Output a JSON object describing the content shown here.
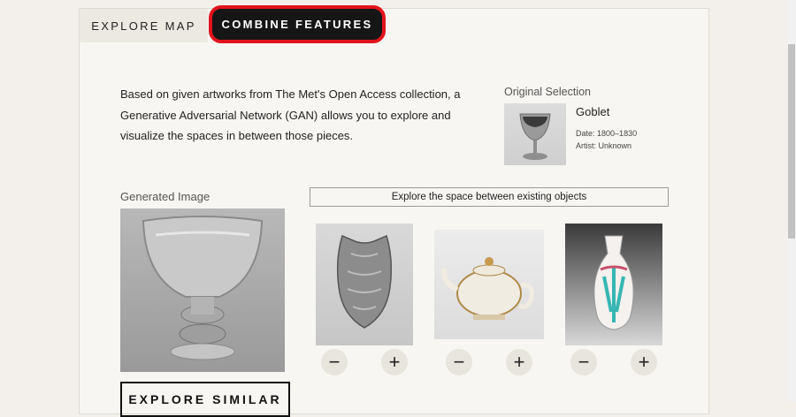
{
  "tabs": {
    "explore_map": "Explore Map",
    "combine_features": "Combine Features"
  },
  "intro_text": "Based on given artworks from The Met's Open Access collection, a Generative Adversarial Network (GAN) allows you to explore and visualize the spaces in between those pieces.",
  "original_selection": {
    "title": "Original Selection",
    "name": "Goblet",
    "date_label": "Date:",
    "date_value": "1800–1830",
    "artist_label": "Artist:",
    "artist_value": "Unknown"
  },
  "generated_image": {
    "title": "Generated Image"
  },
  "explore_similar_label": "Explore Similar",
  "explore_space_label": "Explore the space between existing objects",
  "objects": [
    {
      "name": "breastplate",
      "minus": "−",
      "plus": "+"
    },
    {
      "name": "teapot",
      "minus": "−",
      "plus": "+"
    },
    {
      "name": "vase",
      "minus": "−",
      "plus": "+"
    }
  ],
  "colors": {
    "accent_red": "#e1141c",
    "tab_active_bg": "#161616",
    "page_bg": "#f3f0eb"
  }
}
